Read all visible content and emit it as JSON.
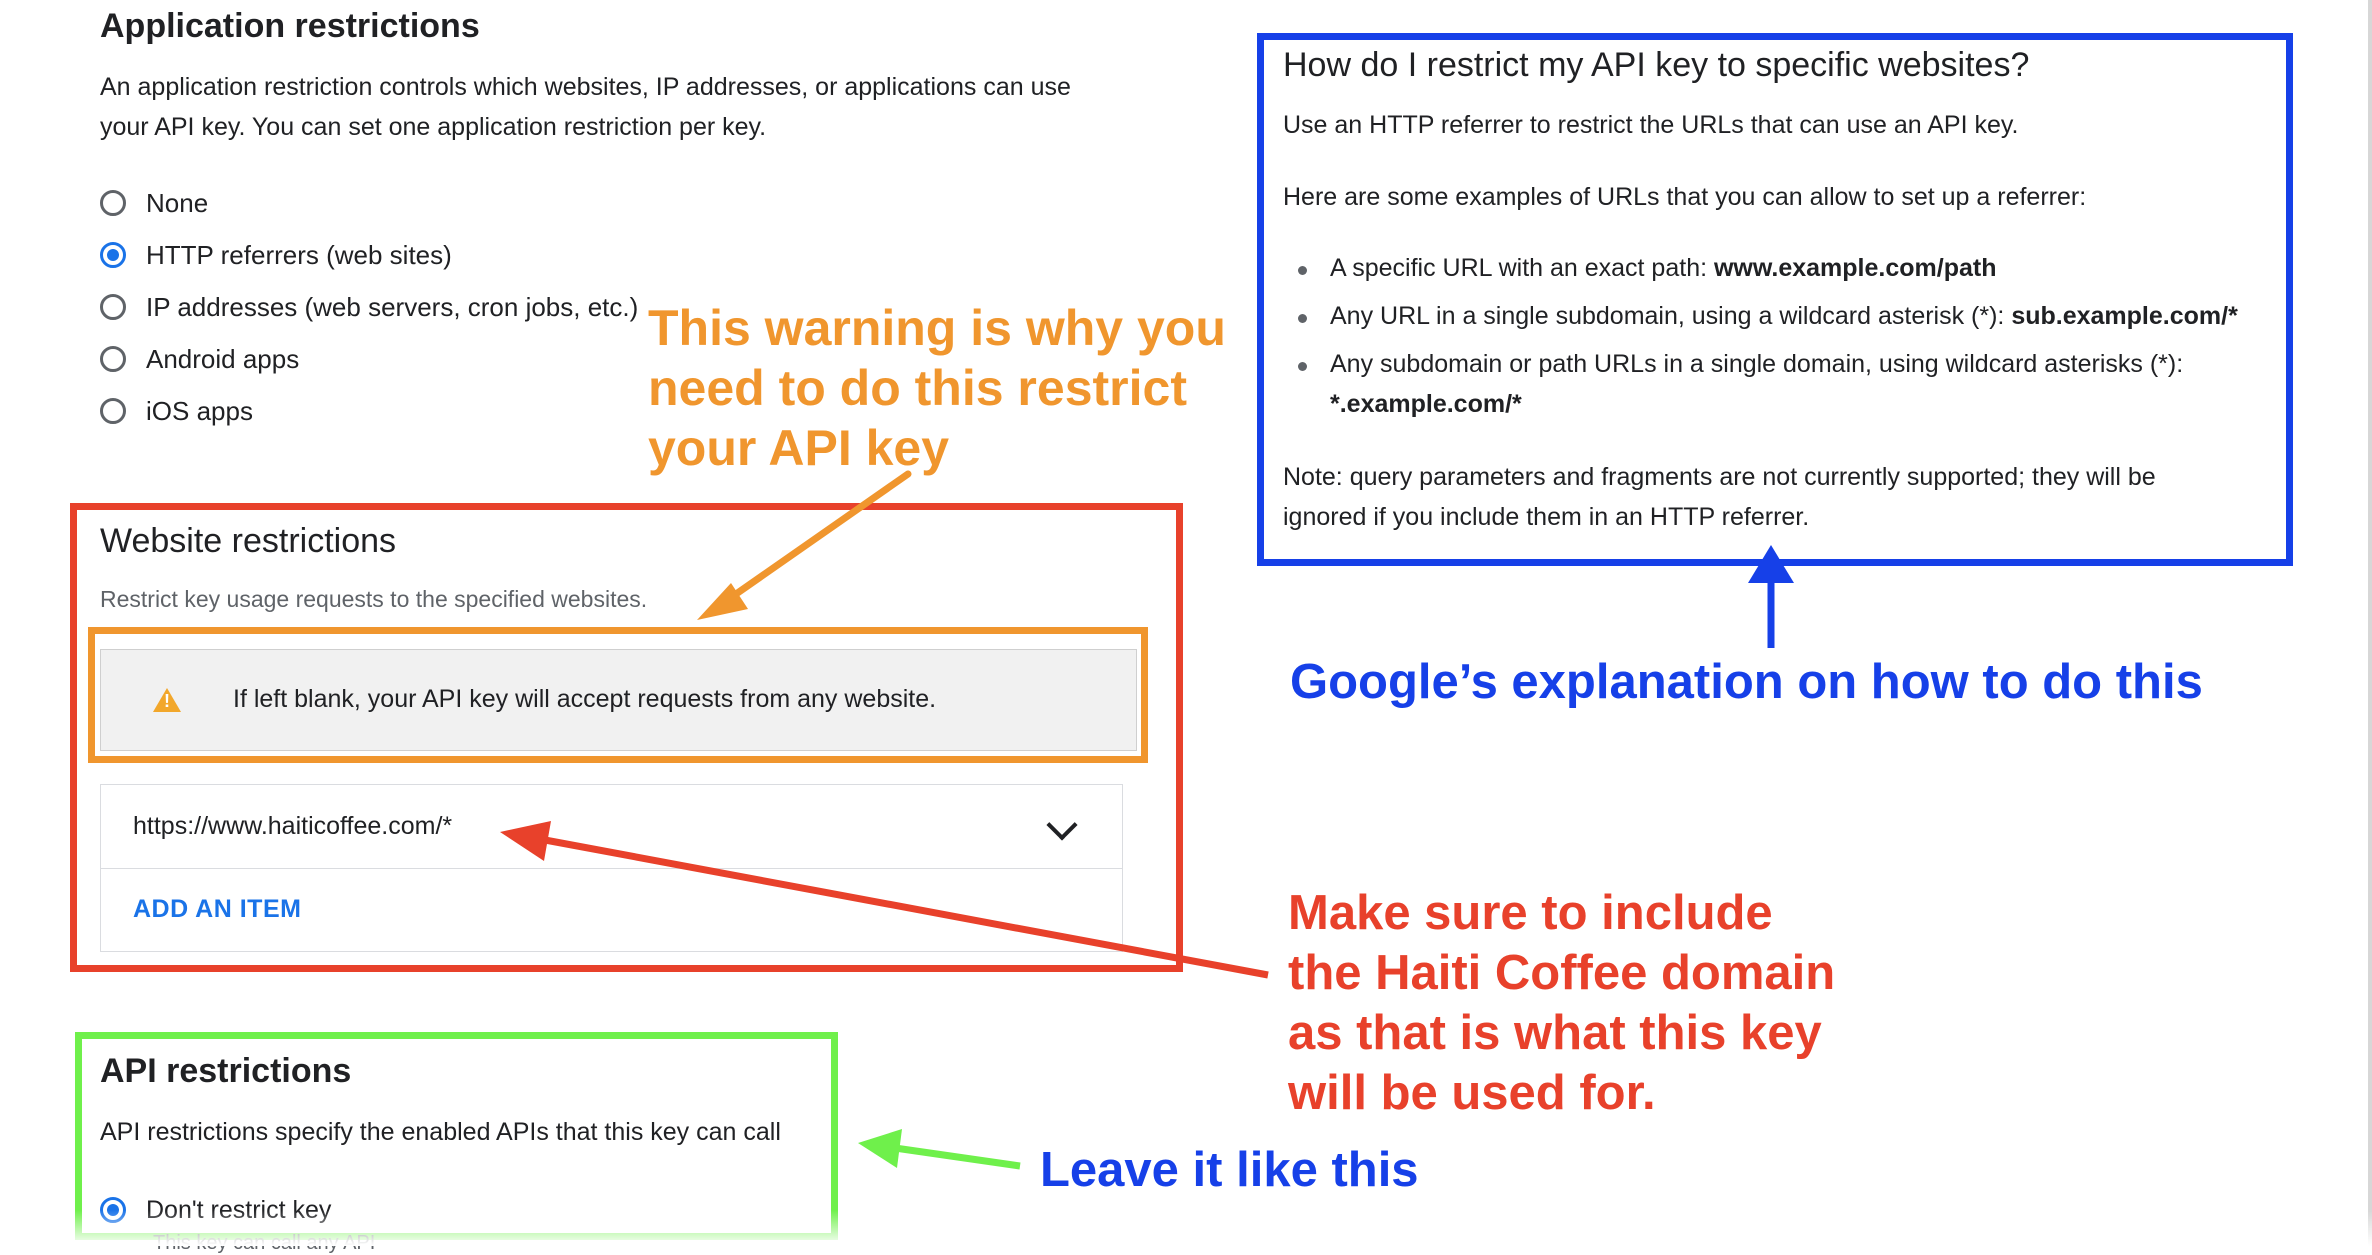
{
  "application_restrictions": {
    "title": "Application restrictions",
    "description_line1": "An application restriction controls which websites, IP addresses, or applications can use",
    "description_line2": "your API key. You can set one application restriction per key.",
    "options": [
      {
        "label": "None",
        "selected": false
      },
      {
        "label": "HTTP referrers (web sites)",
        "selected": true
      },
      {
        "label": "IP addresses (web servers, cron jobs, etc.)",
        "selected": false
      },
      {
        "label": "Android apps",
        "selected": false
      },
      {
        "label": "iOS apps",
        "selected": false
      }
    ]
  },
  "website_restrictions": {
    "title": "Website restrictions",
    "description": "Restrict key usage requests to the specified websites.",
    "warning": "If left blank, your API key will accept requests from any website.",
    "item_value": "https://www.haiticoffee.com/*",
    "add_item_label": "ADD AN ITEM"
  },
  "api_restrictions": {
    "title": "API restrictions",
    "description": "API restrictions specify the enabled APIs that this key can call",
    "option_label": "Don't restrict key",
    "option_hint": "This key can call any API"
  },
  "help_panel": {
    "title": "How do I restrict my API key to specific websites?",
    "intro": "Use an HTTP referrer to restrict the URLs that can use an API key.",
    "examples_intro": "Here are some examples of URLs that you can allow to set up a referrer:",
    "examples": [
      {
        "text": "A specific URL with an exact path: ",
        "bold": "www.example.com/path"
      },
      {
        "text": "Any URL in a single subdomain, using a wildcard asterisk (*): ",
        "bold": "sub.example.com/*"
      },
      {
        "text": "Any subdomain or path URLs in a single domain, using wildcard asterisks (*):",
        "bold": "*.example.com/*"
      }
    ],
    "note_line1": "Note: query parameters and fragments are not currently supported; they will be",
    "note_line2": "ignored if you include them in an HTTP referrer."
  },
  "annotations": {
    "warning_note": [
      "This warning is why you",
      "need to do this restrict",
      "your API key"
    ],
    "google_note": "Google’s explanation on how to do this",
    "domain_note": [
      "Make sure to include",
      "the Haiti Coffee domain",
      "as that is what this key",
      "will be used for."
    ],
    "leave_note": "Leave it like this"
  },
  "colors": {
    "accent_blue": "#1a73e8",
    "annotation_red": "#e8412b",
    "annotation_orange": "#f0962e",
    "annotation_blue": "#1640e8",
    "annotation_green": "#6ff04b",
    "warning_yellow": "#f2a72b"
  },
  "icons": [
    "warning-icon",
    "chevron-down-icon",
    "radio-button"
  ]
}
